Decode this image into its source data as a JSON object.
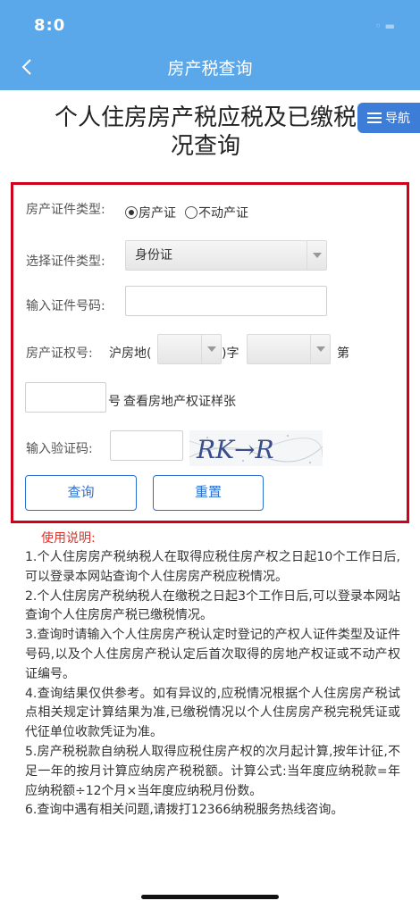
{
  "status_bar": {
    "time": "8:0",
    "right": "◦ ▬"
  },
  "nav": {
    "title": "房产税查询",
    "back_icon": "chevron-left-icon"
  },
  "page": {
    "title": "个人住房房产税应税及已缴税况查询",
    "title_line1": "个人住房房产税应税及已缴税",
    "title_line2": "况查询"
  },
  "guide": {
    "label": "导航",
    "icon": "menu-icon"
  },
  "form": {
    "cert_type_label": "房产证件类型:",
    "cert_type_options": [
      "房产证",
      "不动产证"
    ],
    "cert_type_selected": "房产证",
    "id_type_label": "选择证件类型:",
    "id_type_value": "身份证",
    "id_number_label": "输入证件号码:",
    "id_number_value": "",
    "property_no_label": "房产证权号:",
    "prefix_text": "沪房地(",
    "close_paren_zi": ")字",
    "di_text": "第",
    "hao_text": "号",
    "sample_link": "查看房地产权证样张",
    "captcha_label": "输入验证码:",
    "captcha_value": "",
    "captcha_text": "RK→R",
    "query_button": "查询",
    "reset_button": "重置"
  },
  "instructions": {
    "title": "使用说明:",
    "items": [
      "1.个人住房房产税纳税人在取得应税住房产权之日起10个工作日后,可以登录本网站查询个人住房房产税应税情况。",
      "2.个人住房房产税纳税人在缴税之日起3个工作日后,可以登录本网站查询个人住房房产税已缴税情况。",
      "3.查询时请输入个人住房房产税认定时登记的产权人证件类型及证件号码,以及个人住房房产税认定后首次取得的房地产权证或不动产权证编号。",
      "4.查询结果仅供参考。如有异议的,应税情况根据个人住房房产税试点相关规定计算结果为准,已缴税情况以个人住房房产税完税凭证或代征单位收款凭证为准。",
      "5.房产税税款自纳税人取得应税住房产权的次月起计算,按年计征,不足一年的按月计算应纳房产税税额。计算公式:当年度应纳税款=年应纳税额÷12个月×当年度应纳税月份数。",
      "6.查询中遇有相关问题,请拨打12366纳税服务热线咨询。"
    ]
  },
  "colors": {
    "header": "#5aa7ea",
    "guide": "#3d7dd8",
    "border": "#d0021b",
    "button": "#2e6fd0",
    "note_title": "#e0302a"
  }
}
